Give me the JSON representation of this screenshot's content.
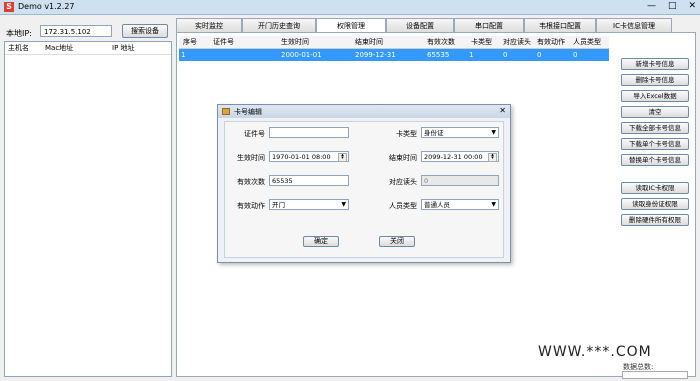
{
  "window": {
    "title": "Demo  v1.2.27",
    "app_icon_glyph": "S"
  },
  "left": {
    "ip_label": "本地IP:",
    "ip_value": "172.31.5.102",
    "search_button": "搜索设备",
    "columns": [
      "主机名",
      "Mac地址",
      "IP 地址"
    ]
  },
  "tabs": [
    {
      "label": "实时监控"
    },
    {
      "label": "开门历史查询"
    },
    {
      "label": "权限管理"
    },
    {
      "label": "设备配置"
    },
    {
      "label": "串口配置"
    },
    {
      "label": "韦根接口配置"
    },
    {
      "label": "IC卡信息管理"
    }
  ],
  "active_tab": "权限管理",
  "grid": {
    "columns": [
      "序号",
      "证件号",
      "生效时间",
      "结束时间",
      "有效次数",
      "卡类型",
      "对应读头",
      "有效动作",
      "人员类型"
    ],
    "rows": [
      [
        "1",
        "",
        "2000-01-01",
        "2099-12-31",
        "65535",
        "1",
        "0",
        "0",
        "0"
      ]
    ]
  },
  "side_buttons": [
    "新增卡号信息",
    "删除卡号信息",
    "导入Excel数据",
    "清空",
    "下载全部卡号信息",
    "下载单个卡号信息",
    "替换单个卡号信息",
    "读取IC卡权限",
    "读取身份证权限",
    "删除硬件所有权限"
  ],
  "bottom_label": "数据总数:",
  "dialog": {
    "title": "卡号编辑",
    "fields": {
      "id_label": "证件号",
      "id_value": "",
      "card_type_label": "卡类型",
      "card_type_value": "身份证",
      "start_label": "生效时间",
      "start_value": "1970-01-01 08:00",
      "end_label": "结束时间",
      "end_value": "2099-12-31 00:00",
      "count_label": "有效次数",
      "count_value": "65535",
      "reader_label": "对应读头",
      "reader_value": "0",
      "action_label": "有效动作",
      "action_value": "开门",
      "person_label": "人员类型",
      "person_value": "普通人员"
    },
    "ok_button": "确定",
    "close_button": "关闭"
  },
  "watermark": "WWW.***.COM"
}
